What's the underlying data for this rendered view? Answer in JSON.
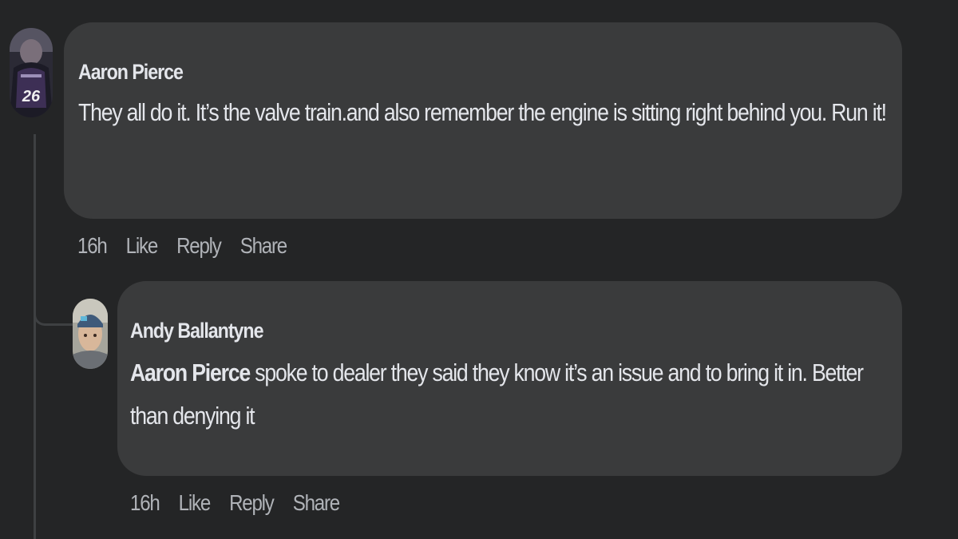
{
  "comments": [
    {
      "author": "Aaron Pierce",
      "avatar_icon": "profile-photo-jersey-26",
      "avatar_jersey_number": "26",
      "text": "They all do it. It’s the valve train.and also remember the engine is sitting right behind you. Run it!",
      "time": "16h",
      "like_label": "Like",
      "reply_label": "Reply",
      "share_label": "Share"
    },
    {
      "author": "Andy Ballantyne",
      "avatar_icon": "profile-photo-man-cap",
      "mention": "Aaron Pierce",
      "text": " spoke to dealer they said they know it’s an issue and to bring it in. Better than denying it",
      "time": "16h",
      "like_label": "Like",
      "reply_label": "Reply",
      "share_label": "Share"
    }
  ],
  "colors": {
    "background": "#242526",
    "bubble": "#3a3b3c",
    "text": "#e4e6eb",
    "secondary_text": "#b0b3b8",
    "thread_line": "#3e4042"
  }
}
